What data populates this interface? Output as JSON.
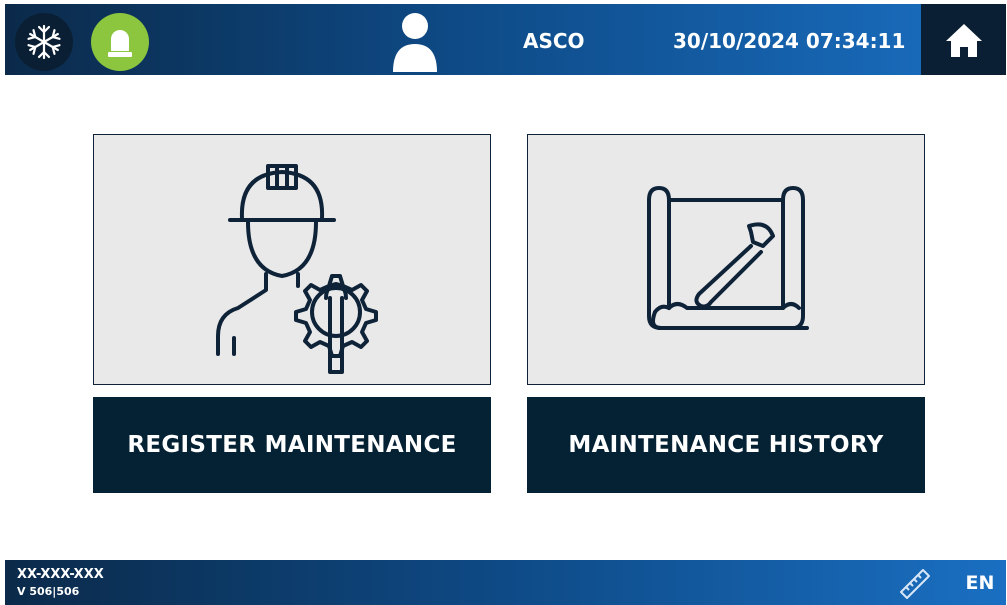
{
  "header": {
    "snowflake_icon": "snowflake-icon",
    "beacon_icon": "warning-beacon-icon",
    "user_icon": "user-icon",
    "user_name": "ASCO",
    "datetime": "30/10/2024 07:34:11",
    "home_icon": "home-icon"
  },
  "tiles": [
    {
      "icon": "maintenance-worker-gear-icon",
      "label": "REGISTER MAINTENANCE"
    },
    {
      "icon": "blueprint-wrench-icon",
      "label": "MAINTENANCE HISTORY"
    }
  ],
  "footer": {
    "serial": "XX-XXX-XXX",
    "version": "V 506|506",
    "ruler_icon": "ruler-icon",
    "language": "EN"
  },
  "colors": {
    "header_dark": "#0b2a4a",
    "header_light": "#1a6fc2",
    "tile_background": "#e9e9ea",
    "tile_label_background": "#052134",
    "beacon_green": "#8cc63f",
    "icon_stroke": "#0f2338"
  }
}
